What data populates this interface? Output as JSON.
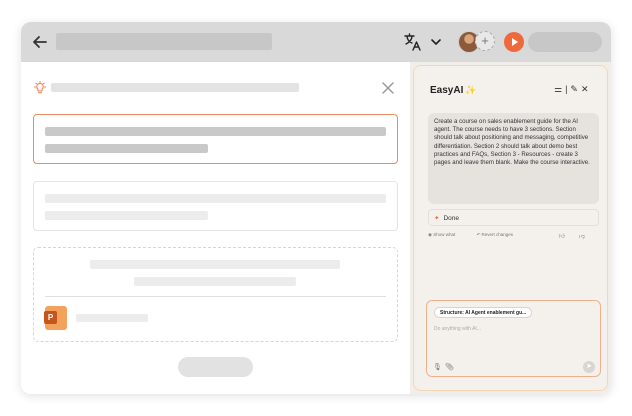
{
  "assistant": {
    "title": "EasyAI",
    "title_sparkle": "✨",
    "prompt_text": "Create a course on sales enablement guide for the AI agent. The course needs to have 3 sections. Section should talk about positioning and messaging, competitive differentiation. Section 2 should talk about demo best practices and FAQs, Section 3 - Resources - create 3 pages and leave them blank. Make the course interactive.",
    "status_label": "Done",
    "action_show": "Show what",
    "action_revert": "Revert changes",
    "chip_label": "Structure: AI Agent enablement gu...",
    "input_placeholder": "Do anything with AI..."
  },
  "file": {
    "badge": "P"
  },
  "colors": {
    "accent": "#ee6a3c",
    "topbar": "#d9d9d9",
    "panel_bg": "#f1eeea"
  }
}
